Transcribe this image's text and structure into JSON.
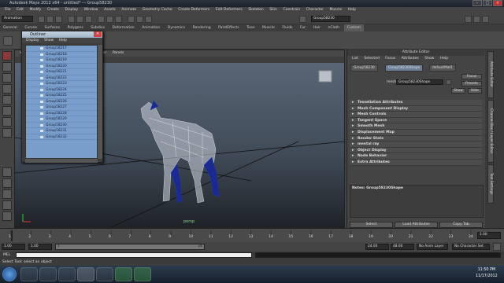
{
  "titlebar": {
    "title": "Autodesk Maya 2012 x64 - untitled*  ---  Group58230"
  },
  "menubar": [
    "File",
    "Edit",
    "Modify",
    "Create",
    "Display",
    "Window",
    "Assets",
    "Animate",
    "Geometry Cache",
    "Create Deformers",
    "Edit Deformers",
    "Skeleton",
    "Skin",
    "Constrain",
    "Character",
    "Muscle",
    "Help"
  ],
  "statusline": {
    "mode": "Animation",
    "field": "Group58230"
  },
  "shelf_tabs": [
    "General",
    "Curves",
    "Surfaces",
    "Polygons",
    "Subdivs",
    "Deformation",
    "Animation",
    "Dynamics",
    "Rendering",
    "PaintEffects",
    "Toon",
    "Muscle",
    "Fluids",
    "Fur",
    "Hair",
    "nCloth",
    "Custom"
  ],
  "shelf_active": "Custom",
  "viewport": {
    "menu": [
      "View",
      "Shading",
      "Lighting",
      "Show",
      "Renderer",
      "Panels"
    ],
    "axis_x": "X",
    "axis_y": "Y",
    "label": "persp"
  },
  "outliner": {
    "title": "Outliner",
    "menu": [
      "Display",
      "Show",
      "Help"
    ],
    "items": [
      "Group58217",
      "Group58218",
      "Group58219",
      "Group58220",
      "Group58221",
      "Group58222",
      "Group58223",
      "Group58224",
      "Group58225",
      "Group58226",
      "Group58227",
      "Group58228",
      "Group58229",
      "Group58230",
      "Group58231",
      "Group58232"
    ]
  },
  "attribute_editor": {
    "header": "Attribute Editor",
    "menu": [
      "List",
      "Selected",
      "Focus",
      "Attributes",
      "Show",
      "Help"
    ],
    "tabs": [
      "Group58230",
      "Group58230Shape",
      "defaultMat1"
    ],
    "mesh_label": "mesh:",
    "mesh_value": "Group58230Shape",
    "focus": "Focus",
    "presets": "Presets",
    "show": "Show",
    "hide": "Hide",
    "sections": [
      "Tessellation Attributes",
      "Mesh Component Display",
      "Mesh Controls",
      "Tangent Space",
      "Smooth Mesh",
      "Displacement Map",
      "Render Stats",
      "mental ray",
      "Object Display",
      "Node Behavior",
      "Extra Attributes"
    ],
    "notes_label": "Notes: Group58230Shape",
    "buttons": [
      "Select",
      "Load Attributes",
      "Copy Tab"
    ]
  },
  "side_tabs": [
    "Attribute Editor",
    "Channel Box / Layer Editor",
    "Tool Settings"
  ],
  "timeline": {
    "ticks": [
      "1",
      "2",
      "3",
      "4",
      "5",
      "6",
      "7",
      "8",
      "9",
      "10",
      "11",
      "12",
      "13",
      "14",
      "15",
      "16",
      "17",
      "18",
      "19",
      "20",
      "21",
      "22",
      "23",
      "24"
    ],
    "current_frame": "1.00"
  },
  "range": {
    "start": "1.00",
    "inner_start": "1.00",
    "inner_end": "1",
    "end": "24",
    "max_end": "24.00",
    "max": "48.00",
    "anim_layer": "No Anim Layer",
    "char_set": "No Character Set"
  },
  "cmdline": {
    "label": "MEL"
  },
  "helpline": {
    "text": "Select Tool: select an object"
  },
  "clock": {
    "time": "11:50 PM",
    "date": "11/17/2012"
  }
}
